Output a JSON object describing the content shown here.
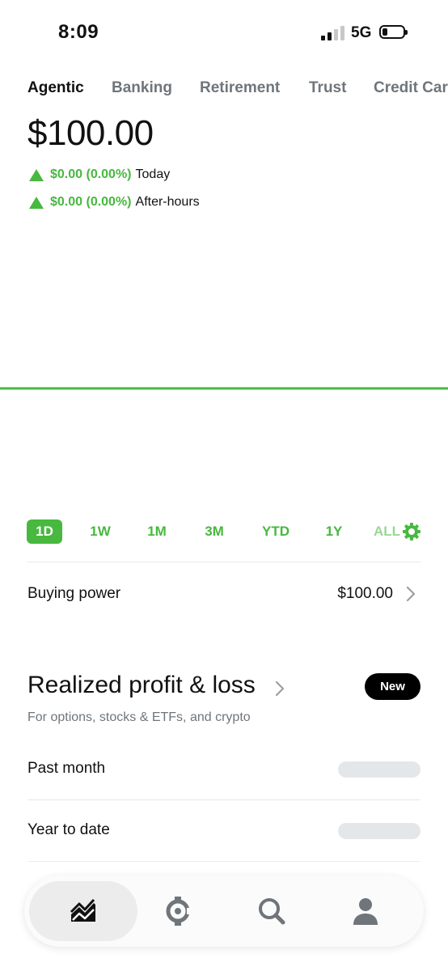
{
  "status_bar": {
    "time": "8:09",
    "network": "5G"
  },
  "account_tabs": [
    {
      "label": "Agentic",
      "active": true
    },
    {
      "label": "Banking",
      "active": false
    },
    {
      "label": "Retirement",
      "active": false
    },
    {
      "label": "Trust",
      "active": false
    },
    {
      "label": "Credit Card",
      "active": false
    }
  ],
  "portfolio": {
    "balance": "$100.00",
    "today_change": "$0.00 (0.00%)",
    "today_label": "Today",
    "after_hours_change": "$0.00 (0.00%)",
    "after_hours_label": "After-hours"
  },
  "chart_data": {
    "type": "line",
    "x": [
      0,
      1
    ],
    "series": [
      {
        "values": [
          100.0,
          100.0
        ]
      }
    ],
    "color": "#48b83f"
  },
  "range_selector": {
    "options": [
      "1D",
      "1W",
      "1M",
      "3M",
      "YTD",
      "1Y",
      "ALL"
    ],
    "selected": "1D",
    "settings_icon": "gear-icon"
  },
  "buying_power": {
    "label": "Buying power",
    "value": "$100.00",
    "icon": "chevron-right-icon"
  },
  "realized_pl": {
    "title": "Realized profit & loss",
    "badge": "New",
    "subtitle": "For options, stocks & ETFs, and crypto",
    "rows": [
      {
        "label": "Past month"
      },
      {
        "label": "Year to date"
      }
    ]
  },
  "bottom_nav": {
    "items": [
      {
        "icon": "investing-chart-icon",
        "active": true
      },
      {
        "icon": "crypto-icon",
        "active": false
      },
      {
        "icon": "search-icon",
        "active": false
      },
      {
        "icon": "profile-icon",
        "active": false
      }
    ]
  },
  "colors": {
    "accent": "#48b83f",
    "muted": "#6f757b",
    "skeleton": "#e4e7ea"
  }
}
